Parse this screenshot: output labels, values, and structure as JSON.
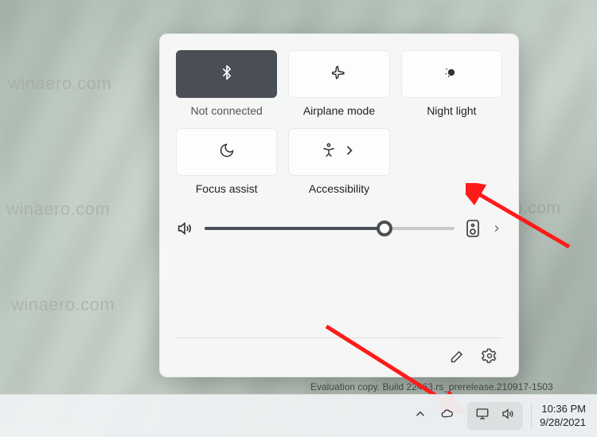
{
  "quick_settings": {
    "tiles": [
      {
        "id": "bluetooth",
        "label": "Not connected",
        "state": "on"
      },
      {
        "id": "airplane",
        "label": "Airplane mode",
        "state": "off"
      },
      {
        "id": "nightlight",
        "label": "Night light",
        "state": "off"
      },
      {
        "id": "focus",
        "label": "Focus assist",
        "state": "off"
      },
      {
        "id": "accessibility",
        "label": "Accessibility",
        "state": "off",
        "has_submenu": true
      }
    ],
    "volume": {
      "percent": 72
    }
  },
  "taskbar": {
    "time": "10:36 PM",
    "date": "9/28/2021"
  },
  "evaluation_text": "Evaluation copy. Build 22463.rs_prerelease.210917-1503",
  "watermark": "winaero.com",
  "colors": {
    "tile_on_bg": "#4a4f56",
    "tile_off_bg": "#fdfdfd",
    "panel_bg": "#f8f8f8",
    "arrow": "#ff1a1a"
  }
}
